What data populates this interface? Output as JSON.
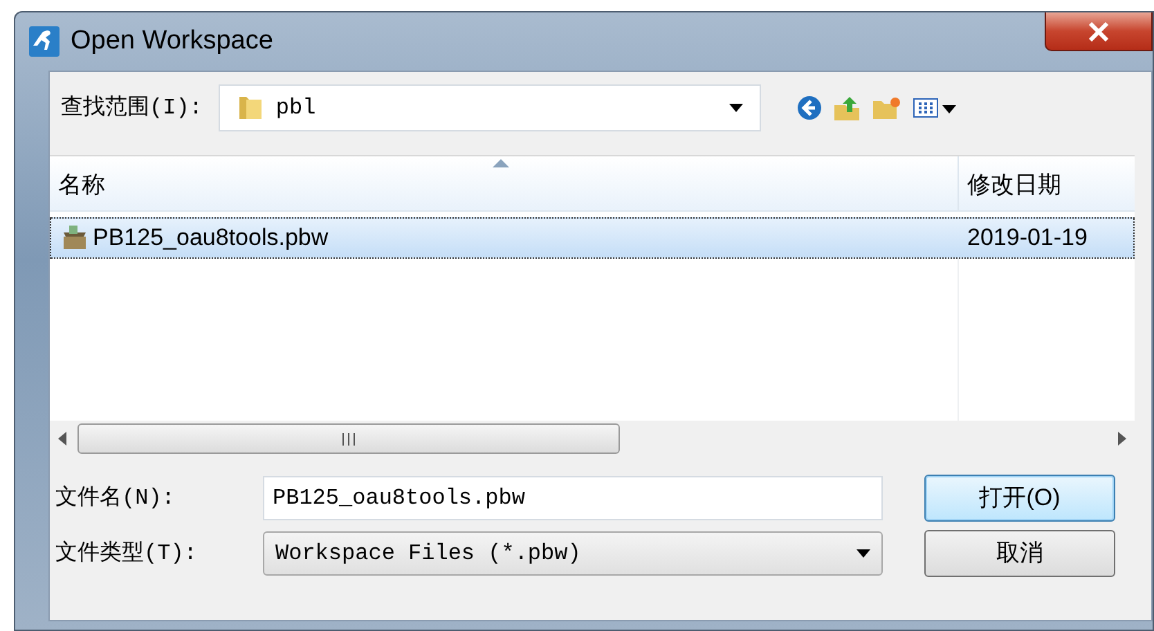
{
  "window": {
    "title": "Open Workspace"
  },
  "look_in": {
    "label": "查找范围(I):",
    "value": "pbl"
  },
  "file_list": {
    "columns": [
      "名称",
      "修改日期"
    ],
    "rows": [
      {
        "name": "PB125_oau8tools.pbw",
        "date": "2019-01-19",
        "selected": true
      }
    ]
  },
  "file_name": {
    "label": "文件名(N):",
    "value": "PB125_oau8tools.pbw"
  },
  "file_type": {
    "label": "文件类型(T):",
    "value": "Workspace Files (*.pbw)"
  },
  "buttons": [
    {
      "label": "打开(O)",
      "default": true
    },
    {
      "label": "取消",
      "default": false
    }
  ]
}
